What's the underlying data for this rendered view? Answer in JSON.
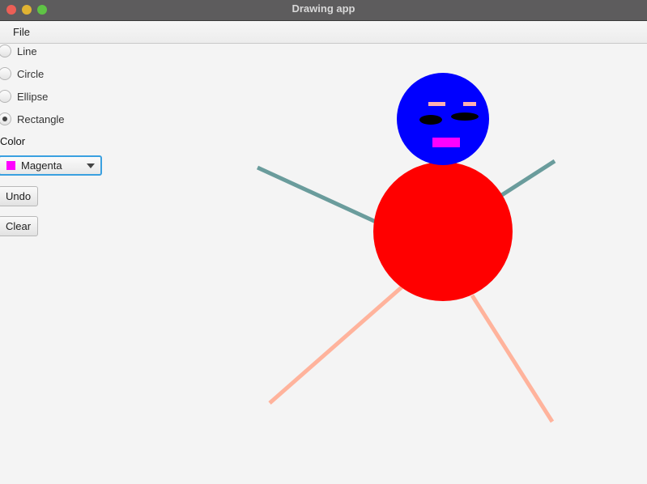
{
  "window": {
    "title": "Drawing app"
  },
  "menu": {
    "file_label": "File"
  },
  "shapes": {
    "items": [
      {
        "label": "Line",
        "selected": false
      },
      {
        "label": "Circle",
        "selected": false
      },
      {
        "label": "Ellipse",
        "selected": false
      },
      {
        "label": "Rectangle",
        "selected": true
      }
    ]
  },
  "color": {
    "label": "Color",
    "selected": "Magenta",
    "swatch": "#ff00ff"
  },
  "buttons": {
    "undo_label": "Undo",
    "clear_label": "Clear"
  },
  "drawing": {
    "head_color": "#0000ff",
    "body_color": "#ff0000",
    "arm_color": "#6a9c9c",
    "leg_color": "#ffb39c",
    "eyebrow_color": "#ffb0b0",
    "eye_color": "#000000",
    "mouth_color": "#ff00ff"
  }
}
